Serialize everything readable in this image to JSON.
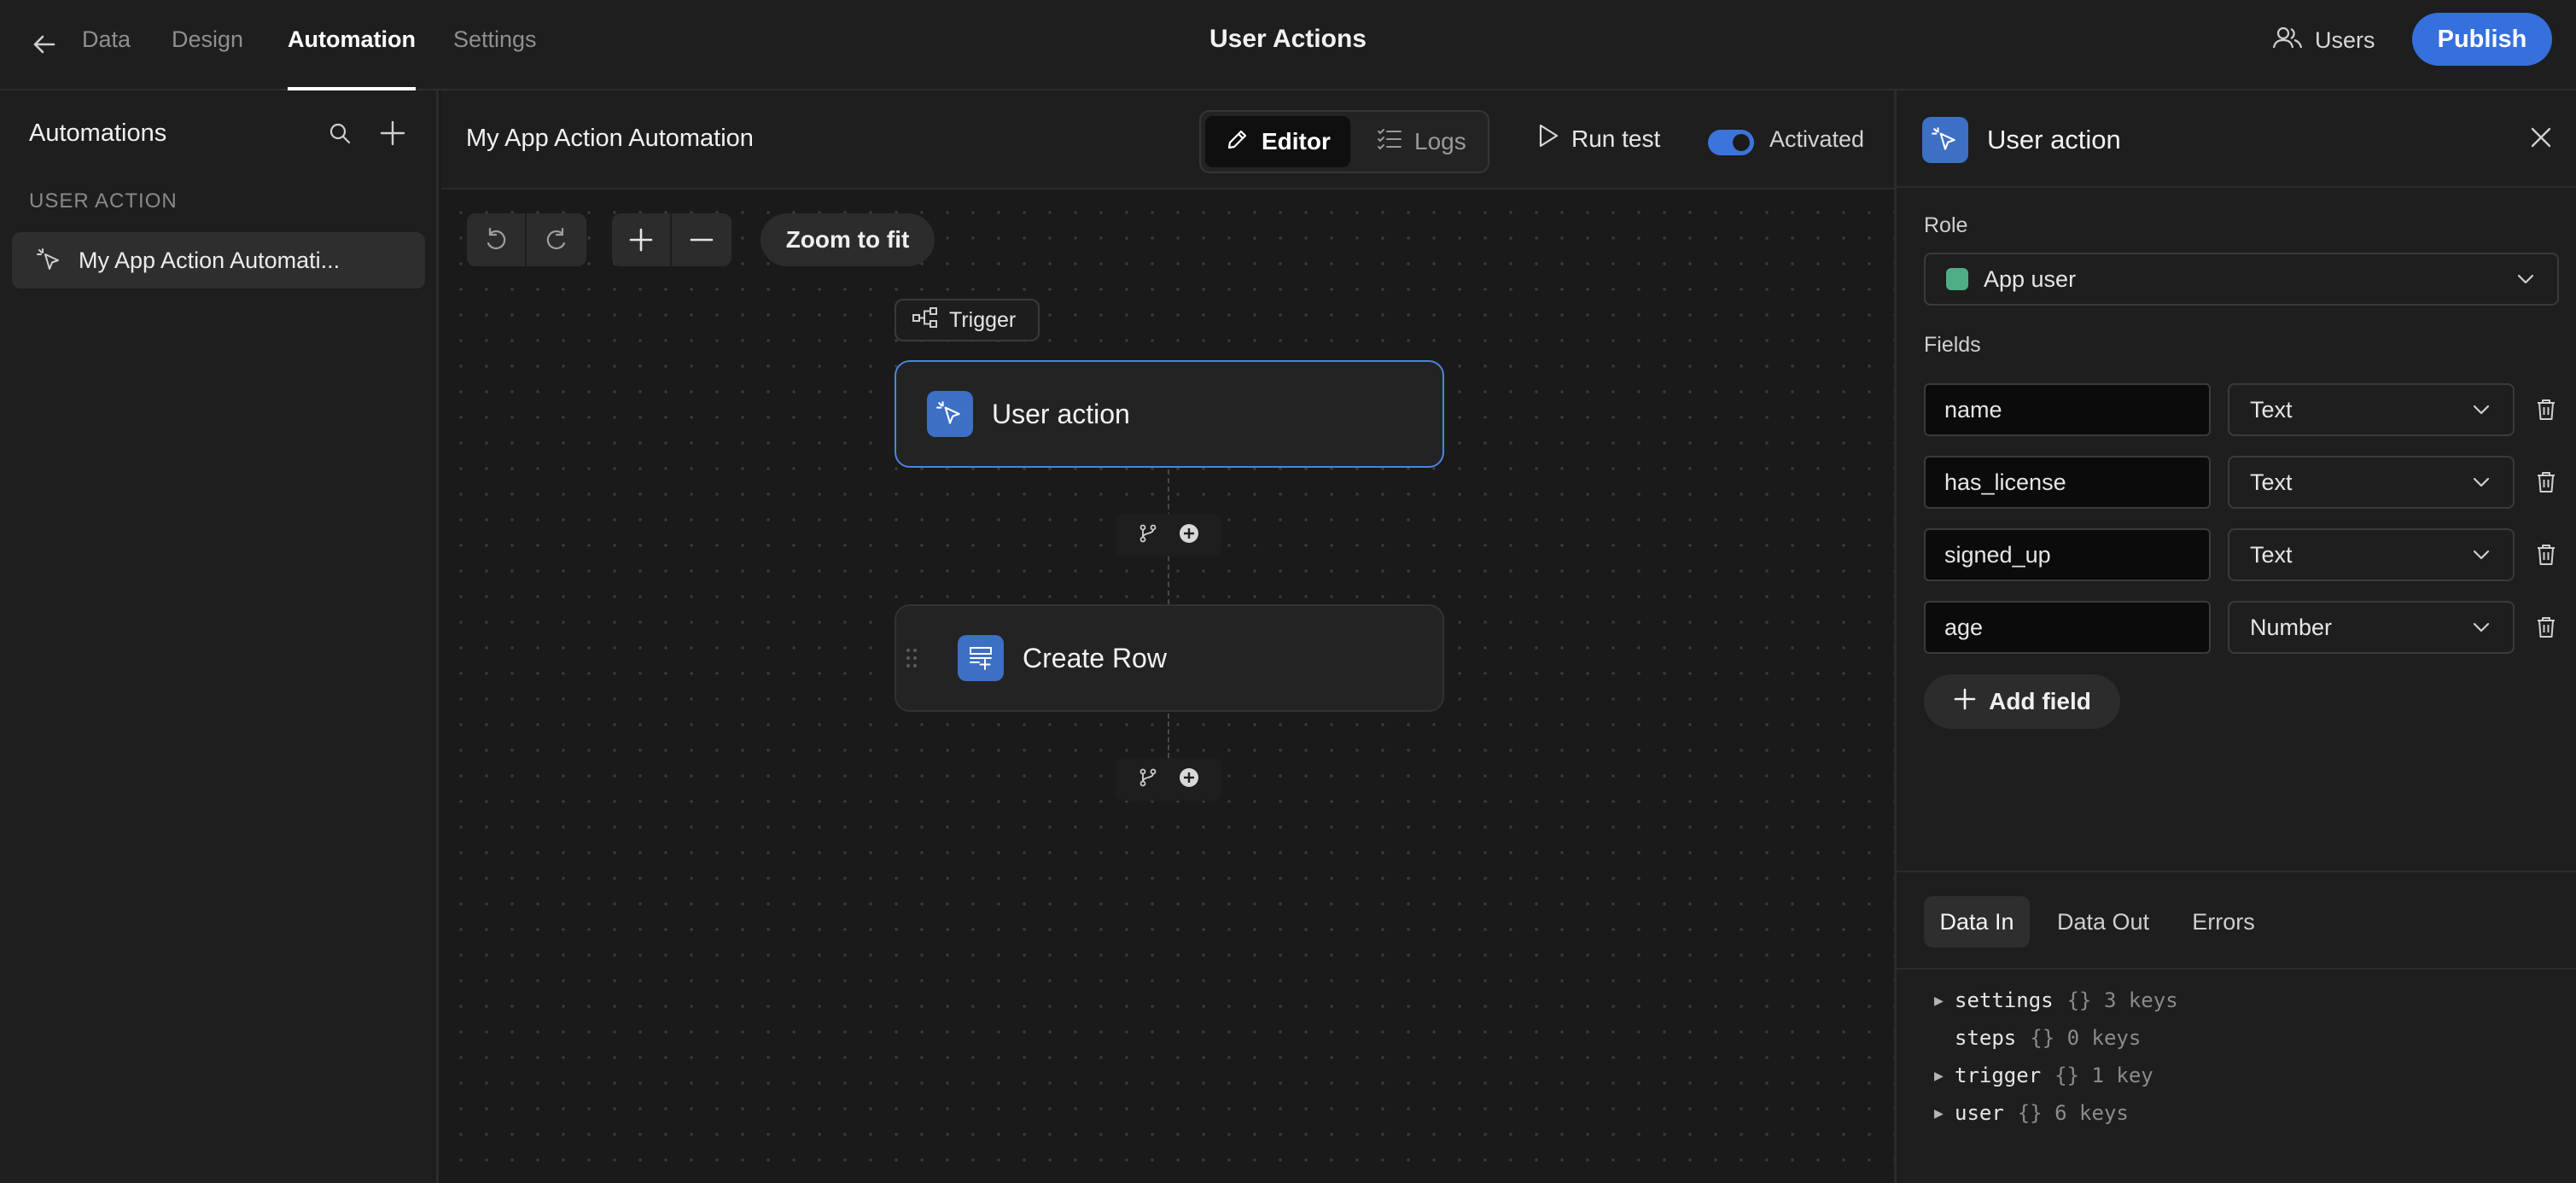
{
  "topbar": {
    "nav": [
      "Data",
      "Design",
      "Automation",
      "Settings"
    ],
    "title": "User Actions",
    "users_label": "Users",
    "publish_label": "Publish"
  },
  "sidebar": {
    "title": "Automations",
    "section": "USER ACTION",
    "items": [
      {
        "label": "My App Action Automati...",
        "icon": "pointer-click-icon"
      }
    ]
  },
  "canvas": {
    "automation_name": "My App Action Automation",
    "editor_label": "Editor",
    "logs_label": "Logs",
    "run_test_label": "Run test",
    "activated_label": "Activated",
    "activated": true,
    "zoom_fit_label": "Zoom to fit",
    "trigger_badge": "Trigger",
    "nodes": [
      {
        "label": "User action",
        "icon": "pointer-click-icon"
      },
      {
        "label": "Create Row",
        "icon": "create-row-icon"
      }
    ]
  },
  "panel": {
    "title": "User action",
    "role_label": "Role",
    "role_value": "App user",
    "fields_label": "Fields",
    "fields": [
      {
        "name": "name",
        "type": "Text"
      },
      {
        "name": "has_license",
        "type": "Text"
      },
      {
        "name": "signed_up",
        "type": "Text"
      },
      {
        "name": "age",
        "type": "Number"
      }
    ],
    "add_field_label": "Add field",
    "data_tabs": [
      "Data In",
      "Data Out",
      "Errors"
    ],
    "json": [
      {
        "key": "settings",
        "meta": "{} 3 keys",
        "expandable": true
      },
      {
        "key": "steps",
        "meta": "{} 0 keys",
        "expandable": false
      },
      {
        "key": "trigger",
        "meta": "{} 1 key",
        "expandable": true
      },
      {
        "key": "user",
        "meta": "{} 6 keys",
        "expandable": true
      }
    ]
  },
  "colors": {
    "accent": "#3570dc",
    "node_icon_bg": "#3d6fc4",
    "role_dot": "#4fae85",
    "toggle_on": "#3c74de"
  }
}
